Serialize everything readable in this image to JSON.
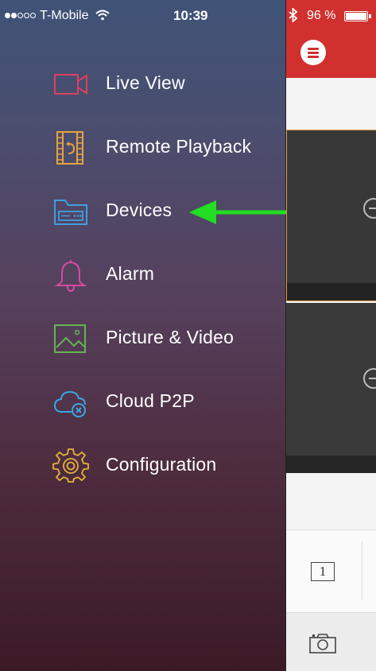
{
  "status": {
    "carrier": "T-Mobile",
    "time": "10:39",
    "battery": "96 %"
  },
  "menu": {
    "items": [
      {
        "label": "Live View",
        "icon": "live-view-icon"
      },
      {
        "label": "Remote Playback",
        "icon": "remote-playback-icon"
      },
      {
        "label": "Devices",
        "icon": "devices-icon"
      },
      {
        "label": "Alarm",
        "icon": "alarm-bell-icon"
      },
      {
        "label": "Picture & Video",
        "icon": "picture-video-icon"
      },
      {
        "label": "Cloud P2P",
        "icon": "cloud-p2p-icon"
      },
      {
        "label": "Configuration",
        "icon": "configuration-gear-icon"
      }
    ]
  },
  "toolbar": {
    "layout_value": "1"
  },
  "colors": {
    "header_red": "#d0312f",
    "annotation_green": "#22dd22",
    "selected_border": "#e4a03a"
  }
}
